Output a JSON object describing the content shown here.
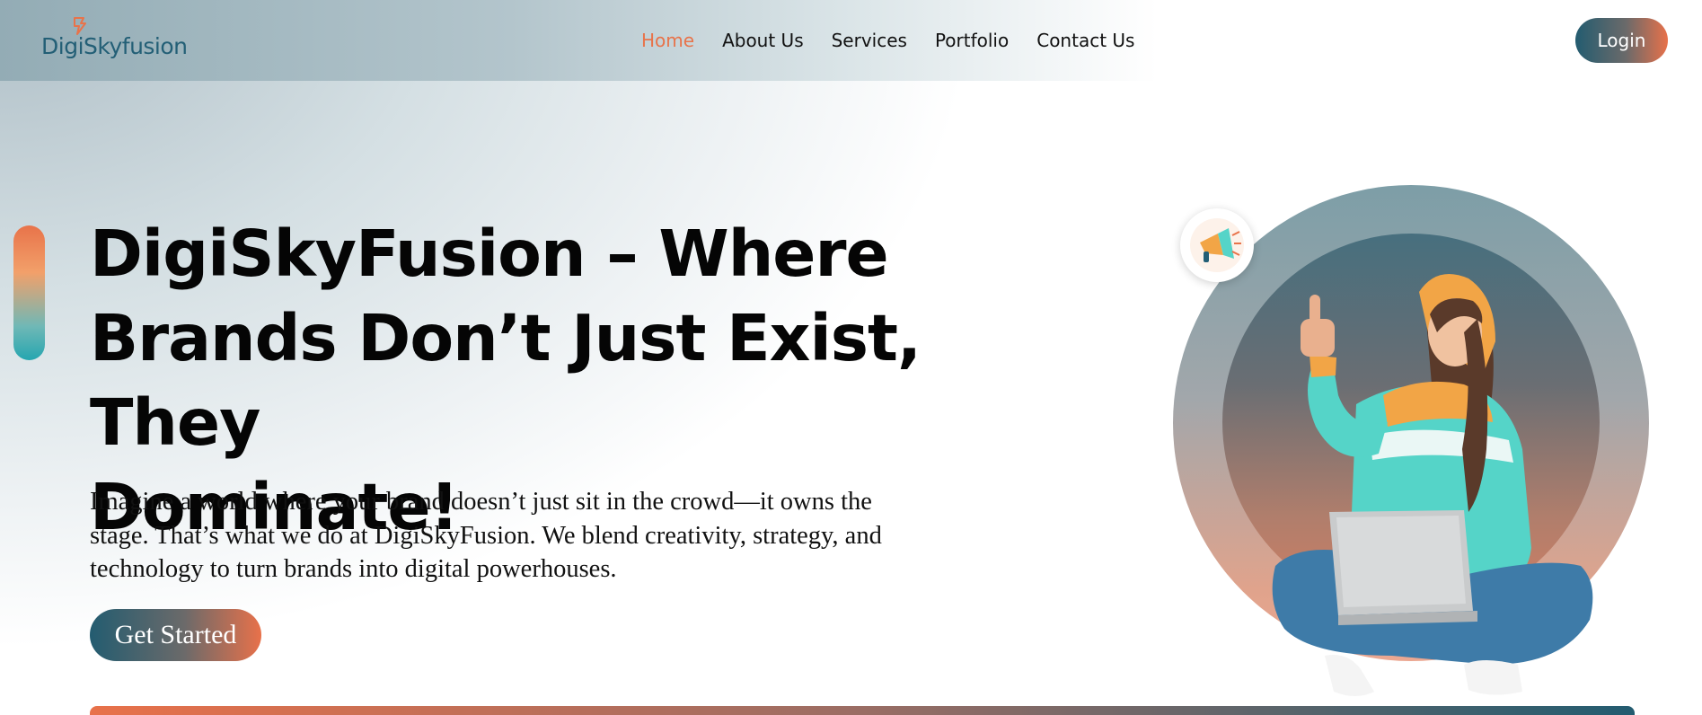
{
  "header": {
    "logo_text": "DigiSkyfusion",
    "nav": [
      {
        "label": "Home",
        "active": true
      },
      {
        "label": "About Us"
      },
      {
        "label": "Services"
      },
      {
        "label": "Portfolio"
      },
      {
        "label": "Contact Us"
      }
    ],
    "login_label": "Login"
  },
  "hero": {
    "title_lines": [
      "DigiSkyFusion – Where",
      "Brands Don’t Just Exist, They",
      "Dominate!"
    ],
    "paragraph_lines": [
      "Imagine a world where your brand doesn’t just sit in the crowd—it owns the",
      "stage. That’s what we do at DigiSkyFusion. We blend creativity, strategy, and",
      "technology to turn brands into digital powerhouses."
    ],
    "cta_label": "Get Started"
  },
  "illustration": {
    "badge_icon": "megaphone-icon",
    "figure": "woman-with-laptop-thumbs-up"
  },
  "colors": {
    "accent": "#e8734a",
    "brand_dark": "#235f76",
    "text": "#050505"
  }
}
